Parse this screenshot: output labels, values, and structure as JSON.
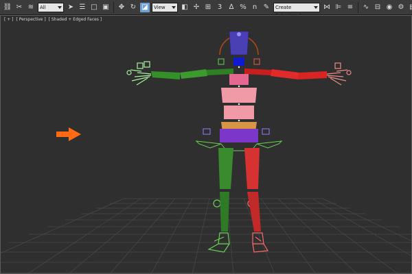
{
  "toolbar": {
    "filter_value": "All",
    "ref_coord_value": "View",
    "selection_set_placeholder": "Create Selection Se",
    "snap_label": "3",
    "angle_snap_label": "∆",
    "percent_snap_label": "%",
    "spinner_snap_label": "n",
    "icons": [
      "select-and-link-icon",
      "unlink-icon",
      "bind-spacewarp-icon",
      "select-object-icon",
      "select-by-name-icon",
      "rect-region-icon",
      "window-crossing-icon",
      "select-move-icon",
      "select-rotate-icon",
      "select-scale-icon",
      "use-pivot-icon",
      "manipulate-icon",
      "keyboard-shortcut-icon",
      "edit-named-selection-icon",
      "mirror-icon",
      "align-icon",
      "layer-manager-icon",
      "curve-editor-icon",
      "schematic-view-icon",
      "material-editor-icon",
      "render-setup-icon",
      "rendered-frame-icon",
      "render-icon"
    ]
  },
  "viewport": {
    "label_parts": [
      "[ + ]",
      "[ Perspective ]",
      "[ Shaded + Edged Faces ]"
    ],
    "arrow_color": "#ff6a13",
    "grid_color": "#4a4a4a",
    "background_color": "#2f2f2f"
  },
  "rig": {
    "colors": {
      "head": "#4a3fb4",
      "neck": "#0d1acd",
      "spine_pink": "#e46890",
      "spine_light": "#f09aa7",
      "pelvis_orange": "#d89545",
      "pelvis_purple": "#7b37c9",
      "left_arm": "#3c9a2e",
      "right_arm": "#e12a2a",
      "left_leg": "#3a8a2e",
      "right_leg": "#d63232",
      "hand_left": "#a9f4a0",
      "hand_right": "#f08a8a",
      "helper": "#6bd35a",
      "head_gizmo": "#b04a12"
    }
  }
}
